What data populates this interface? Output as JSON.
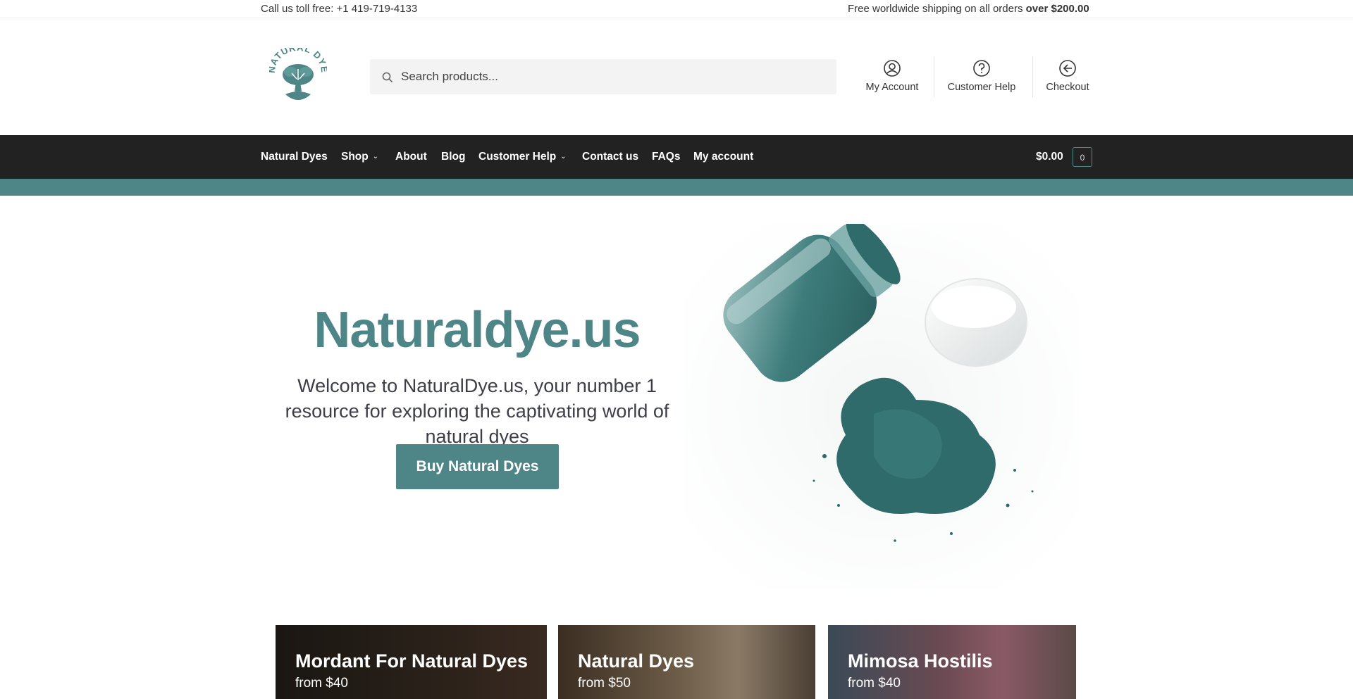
{
  "topbar": {
    "phone_text": "Call us toll free: +1 419-719-4133",
    "shipping_text": "Free worldwide shipping on all orders ",
    "shipping_emphasis": "over $200.00"
  },
  "logo": {
    "text": "NATURAL DYE"
  },
  "search": {
    "placeholder": "Search products..."
  },
  "header_links": [
    {
      "label": "My Account",
      "icon": "user-circle-icon"
    },
    {
      "label": "Customer Help",
      "icon": "help-circle-icon"
    },
    {
      "label": "Checkout",
      "icon": "arrow-circle-icon"
    }
  ],
  "nav": {
    "items": [
      {
        "label": "Natural Dyes"
      },
      {
        "label": "Shop",
        "dropdown": true
      },
      {
        "label": "About"
      },
      {
        "label": "Blog"
      },
      {
        "label": "Customer Help",
        "dropdown": true
      },
      {
        "label": "Contact us"
      },
      {
        "label": "FAQs"
      },
      {
        "label": "My account"
      }
    ],
    "cart_amount": "$0.00",
    "cart_count": "0"
  },
  "hero": {
    "title": "Naturaldye.us",
    "subtitle": "Welcome to NaturalDye.us, your number 1 resource for exploring the captivating world of natural dyes",
    "button": "Buy Natural Dyes"
  },
  "categories": [
    {
      "title": "Mordant For Natural Dyes",
      "price": "from $40"
    },
    {
      "title": "Natural Dyes",
      "price": "from $50"
    },
    {
      "title": "Mimosa Hostilis",
      "price": "from $40"
    }
  ],
  "colors": {
    "accent": "#4e8688",
    "navbar": "#222222",
    "powder": "#2f6b6a"
  }
}
